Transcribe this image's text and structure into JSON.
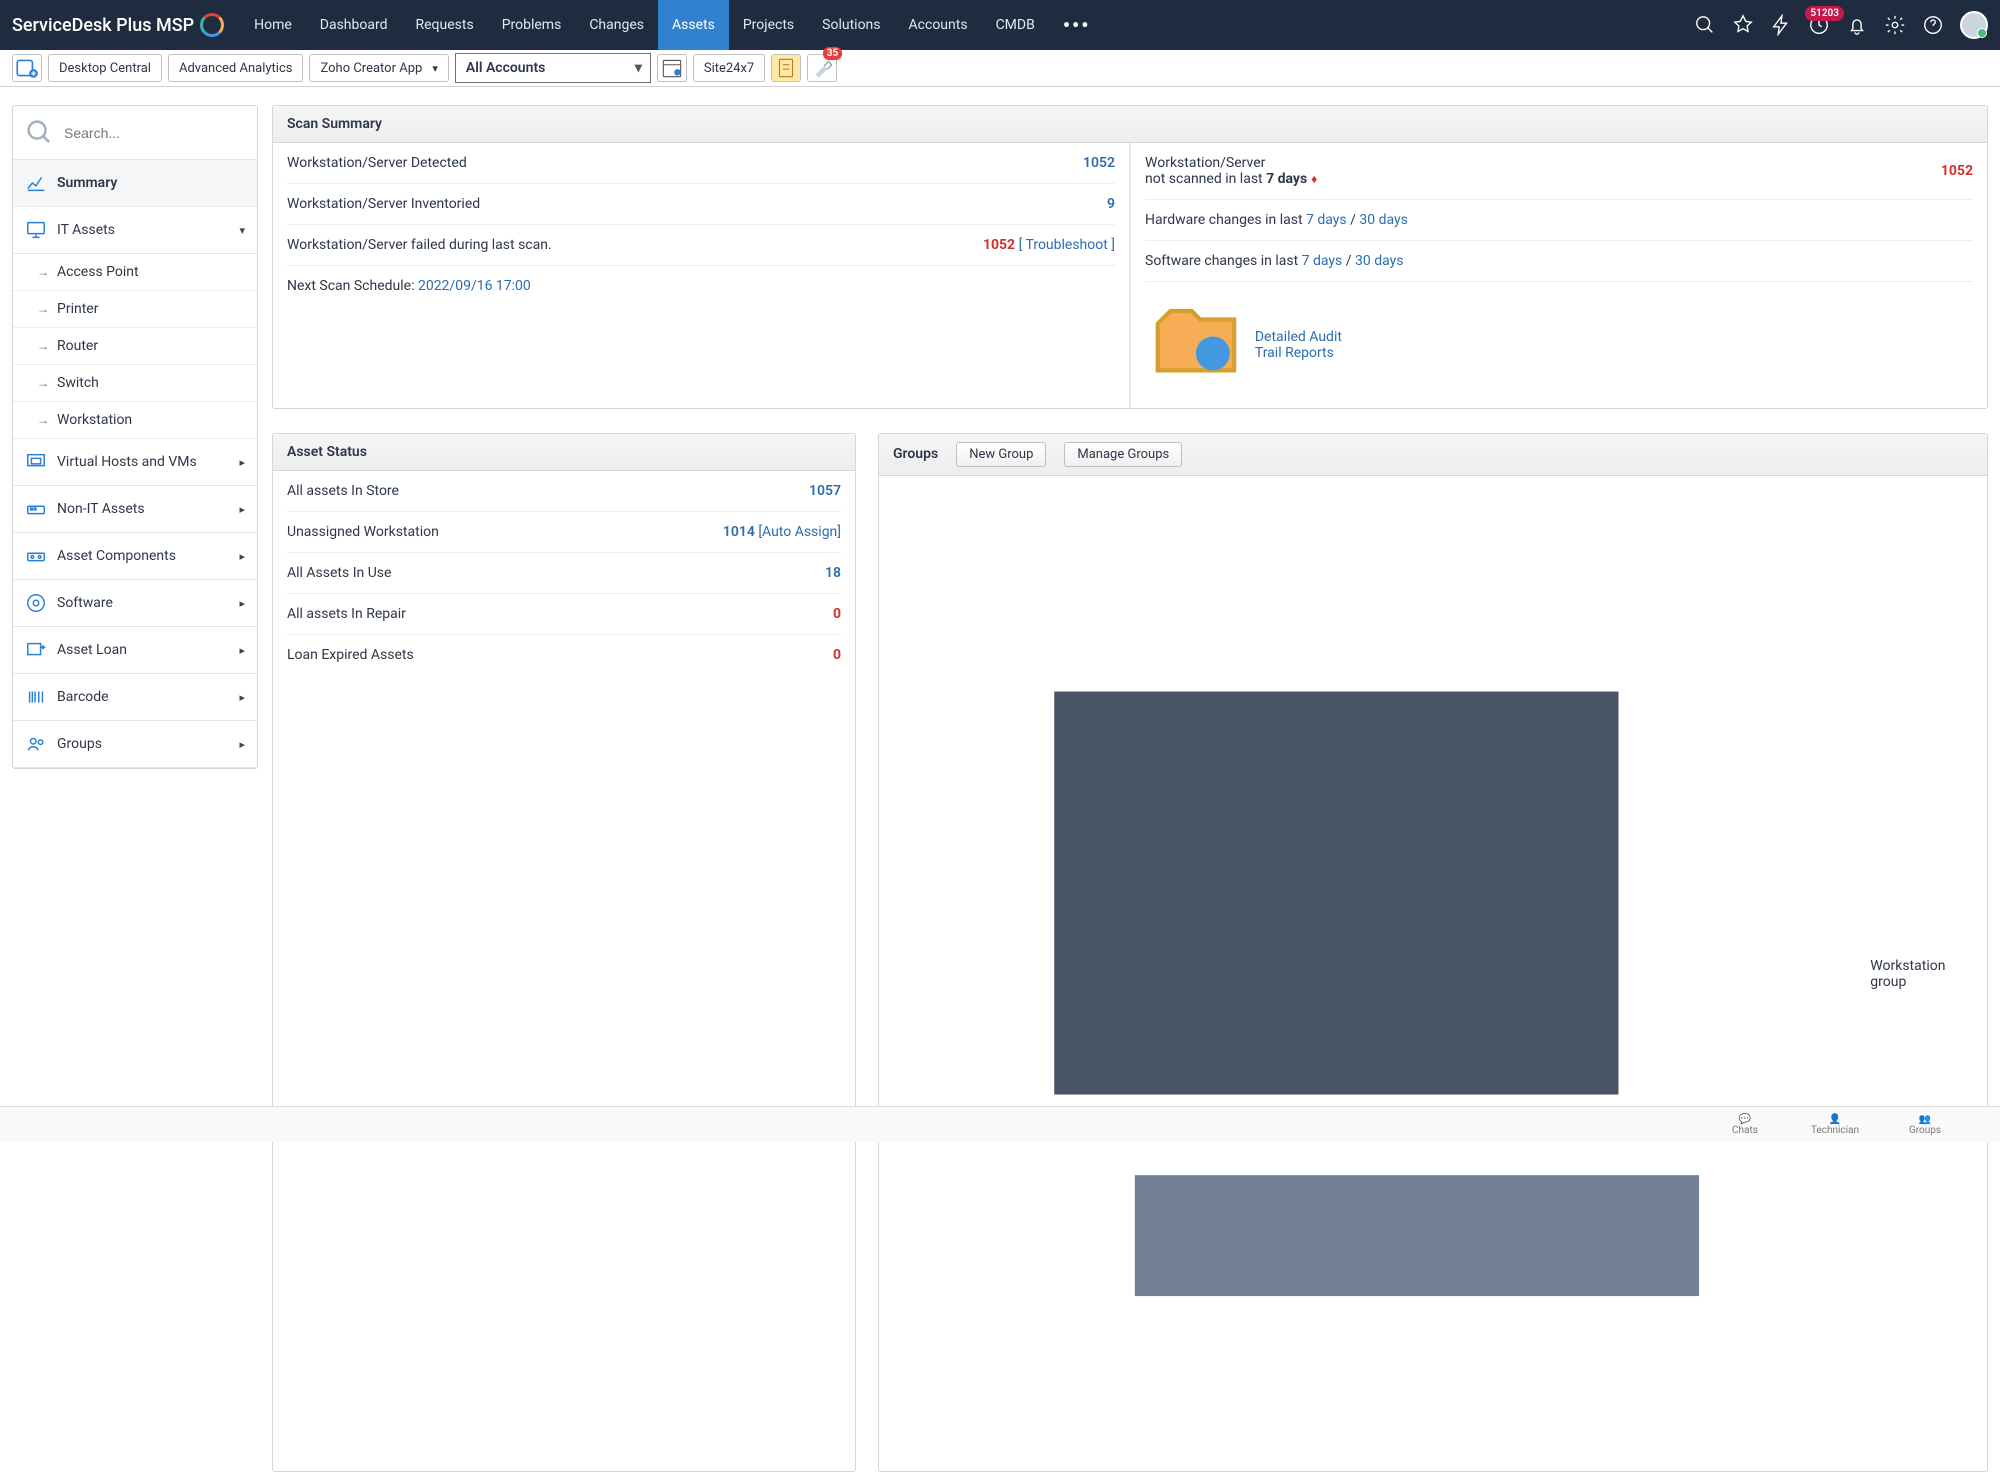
{
  "brand": "ServiceDesk Plus MSP",
  "nav": [
    "Home",
    "Dashboard",
    "Requests",
    "Problems",
    "Changes",
    "Assets",
    "Projects",
    "Solutions",
    "Accounts",
    "CMDB"
  ],
  "nav_active": "Assets",
  "notif_count": "51203",
  "toolbar": {
    "desktop_central": "Desktop Central",
    "advanced_analytics": "Advanced Analytics",
    "zoho_creator": "Zoho Creator App",
    "accounts": "All Accounts",
    "site24x7": "Site24x7",
    "pin_badge": "35"
  },
  "search_placeholder": "Search...",
  "sidebar": {
    "summary": "Summary",
    "it_assets": "IT Assets",
    "it_children": [
      "Access Point",
      "Printer",
      "Router",
      "Switch",
      "Workstation"
    ],
    "others": [
      "Virtual Hosts and VMs",
      "Non-IT Assets",
      "Asset Components",
      "Software",
      "Asset Loan",
      "Barcode",
      "Groups"
    ]
  },
  "scan": {
    "title": "Scan Summary",
    "detected_label": "Workstation/Server Detected",
    "detected_val": "1052",
    "inventoried_label": "Workstation/Server Inventoried",
    "inventoried_val": "9",
    "failed_label": "Workstation/Server failed during last scan.",
    "failed_val": "1052",
    "troubleshoot": "[ Troubleshoot ]",
    "next_scan_label": "Next Scan Schedule: ",
    "next_scan_val": "2022/09/16 17:00",
    "not_scanned_line1": "Workstation/Server",
    "not_scanned_line2_a": "not scanned in last ",
    "not_scanned_line2_b": "7 days",
    "not_scanned_val": "1052",
    "hw_label": "Hardware changes in last ",
    "sw_label": "Software changes in last ",
    "d7": "7 days",
    "d30": "30 days",
    "slash": "  /  ",
    "audit": "Detailed Audit Trail Reports"
  },
  "asset_status": {
    "title": "Asset Status",
    "rows": [
      {
        "label": "All assets In Store",
        "value": "1057",
        "color": "blue"
      },
      {
        "label": "Unassigned Workstation",
        "value": "1014",
        "extra": "[Auto Assign]",
        "color": "blue"
      },
      {
        "label": "All Assets In Use",
        "value": "18",
        "color": "blue"
      },
      {
        "label": "All assets In Repair",
        "value": "0",
        "color": "red"
      },
      {
        "label": "Loan Expired Assets",
        "value": "0",
        "color": "red"
      }
    ]
  },
  "groups": {
    "title": "Groups",
    "new": "New Group",
    "manage": "Manage Groups",
    "items": [
      "Workstation group"
    ]
  },
  "bottom": {
    "chats": "Chats",
    "technician": "Technician",
    "groups": "Groups"
  }
}
